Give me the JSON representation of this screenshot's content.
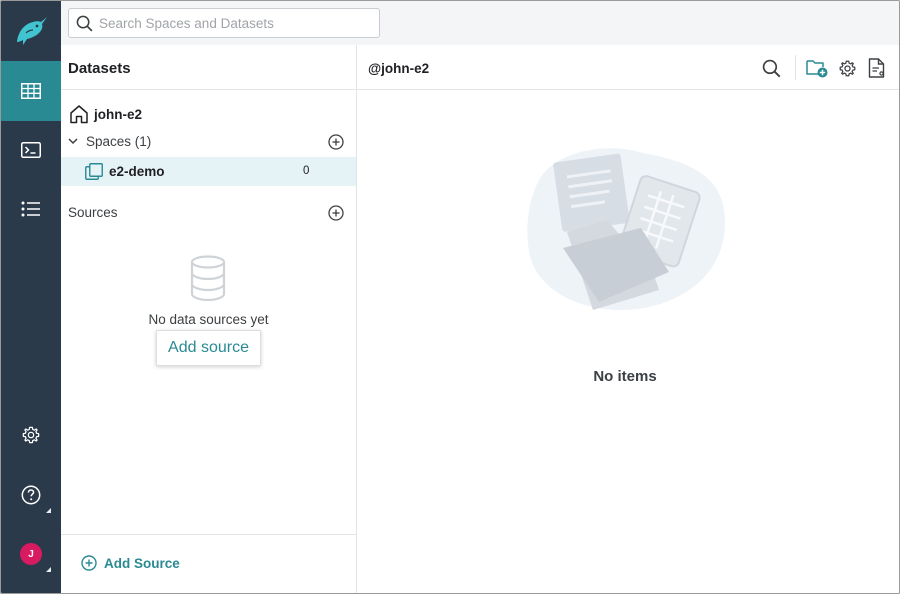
{
  "search": {
    "placeholder": "Search Spaces and Datasets"
  },
  "panel": {
    "title": "Datasets",
    "home_label": "john-e2",
    "spaces_label": "Spaces (1)",
    "spaces": [
      {
        "label": "e2-demo",
        "count": "0"
      }
    ],
    "sources_label": "Sources",
    "empty_text": "No data sources yet",
    "add_source_popup": "Add source",
    "footer_add_source": "Add Source"
  },
  "main": {
    "title": "@john-e2",
    "empty_text": "No items"
  },
  "user": {
    "initial": "J"
  },
  "colors": {
    "rail": "#2b3a4a",
    "accent": "#2a8a94",
    "selected_row": "#e6f3f6",
    "avatar": "#d81b60"
  },
  "icons": {
    "rail": [
      "narwhal-logo-icon",
      "datasets-grid-icon",
      "sql-terminal-icon",
      "jobs-list-icon",
      "settings-gear-icon",
      "help-icon"
    ],
    "header": [
      "search-icon",
      "add-folder-icon",
      "settings-icon",
      "wiki-document-icon"
    ]
  }
}
